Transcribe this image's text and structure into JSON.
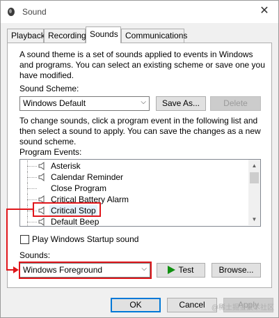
{
  "window": {
    "title": "Sound",
    "close_glyph": "✕"
  },
  "tabs": [
    {
      "label": "Playback"
    },
    {
      "label": "Recording"
    },
    {
      "label": "Sounds"
    },
    {
      "label": "Communications"
    }
  ],
  "sounds": {
    "intro_line1": "A sound theme is a set of sounds applied to events in Windows",
    "intro_line2": "and programs.  You can select an existing scheme or save one you",
    "intro_line3": "have modified.",
    "scheme_label": "Sound Scheme:",
    "scheme_value": "Windows Default",
    "save_as_label": "Save As...",
    "delete_label": "Delete",
    "change_line1": "To change sounds, click a program event in the following list and",
    "change_line2": "then select a sound to apply.  You can save the changes as a new",
    "change_line3": "sound scheme.",
    "events_label": "Program Events:",
    "events": [
      {
        "label": "Asterisk",
        "has_sound": true
      },
      {
        "label": "Calendar Reminder",
        "has_sound": true
      },
      {
        "label": "Close Program",
        "has_sound": false
      },
      {
        "label": "Critical Battery Alarm",
        "has_sound": true
      },
      {
        "label": "Critical Stop",
        "has_sound": true,
        "selected": true
      },
      {
        "label": "Default Beep",
        "has_sound": true
      }
    ],
    "startup_checkbox_label": "Play Windows Startup sound",
    "startup_checked": false,
    "sounds_label": "Sounds:",
    "sound_value": "Windows Foreground",
    "test_label": "Test",
    "browse_label": "Browse..."
  },
  "footer": {
    "ok_label": "OK",
    "cancel_label": "Cancel",
    "apply_label": "Apply"
  },
  "watermark": "@稀土掘金技术社区",
  "colors": {
    "annotation": "#e0161b",
    "play": "#109010",
    "accent": "#0078d7"
  }
}
